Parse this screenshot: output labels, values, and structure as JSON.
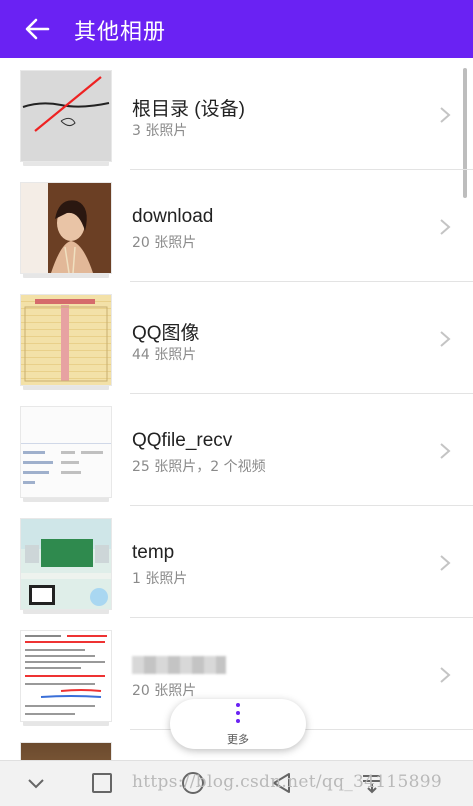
{
  "appbar": {
    "title": "其他相册",
    "back_icon": "back-arrow-icon",
    "color": "#6a22f3"
  },
  "albums": [
    {
      "name": "根目录 (设备)",
      "count": "3 张照片"
    },
    {
      "name": "download",
      "count": "20 张照片"
    },
    {
      "name": "QQ图像",
      "count": "44 张照片"
    },
    {
      "name": "QQfile_recv",
      "count": "25 张照片，2 个视频"
    },
    {
      "name": "temp",
      "count": "1 张照片"
    },
    {
      "name": "",
      "count": "20 张照片"
    }
  ],
  "more_button": {
    "label": "更多",
    "icon": "more-vertical-icon"
  },
  "navbar": {
    "icons": [
      "collapse-icon",
      "recent-apps-icon",
      "home-icon",
      "back-icon",
      "notification-icon"
    ]
  },
  "watermark": "https://blog.csdn.net/qq_34115899"
}
